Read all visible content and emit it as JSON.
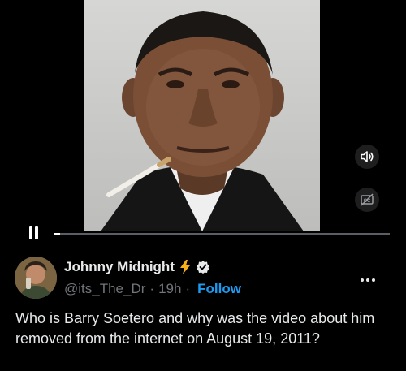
{
  "video": {
    "controls": {
      "pause_icon": "pause-icon",
      "volume_icon": "speaker-icon",
      "captions_icon": "captions-off-icon",
      "progress_fraction": 0.02
    }
  },
  "tweet": {
    "author": {
      "display_name": "Johnny Midnight",
      "handle": "@its_The_Dr",
      "badges": [
        "lightning-icon",
        "verified-badge-icon"
      ],
      "avatar_icon": "avatar"
    },
    "time": "19h",
    "separator": "·",
    "follow_label": "Follow",
    "more_icon": "more-icon",
    "text": "Who is Barry Soetero and why was the video about him removed from the internet on August 19, 2011?"
  },
  "colors": {
    "background": "#000000",
    "text": "#e7e9ea",
    "secondary_text": "#71767b",
    "accent": "#1d9bf0",
    "lightning": "#f7b21b"
  }
}
